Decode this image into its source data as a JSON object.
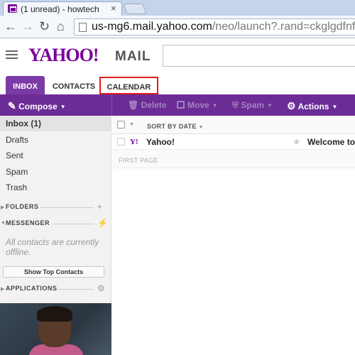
{
  "browser": {
    "tab_title": "(1 unread) - howtech",
    "tab_close": "×",
    "url_host": "us-mg6.mail.yahoo.com",
    "url_path": "/neo/launch?.rand=ckglgdfnfa"
  },
  "header": {
    "logo": "YAHOO!",
    "product": "MAIL"
  },
  "tabs": [
    {
      "label": "INBOX"
    },
    {
      "label": "CONTACTS"
    },
    {
      "label": "CALENDAR"
    }
  ],
  "actions": {
    "compose": "Compose",
    "delete": "Delete",
    "move": "Move",
    "spam": "Spam",
    "actions": "Actions"
  },
  "folders": [
    {
      "label": "Inbox (1)"
    },
    {
      "label": "Drafts"
    },
    {
      "label": "Sent"
    },
    {
      "label": "Spam"
    },
    {
      "label": "Trash"
    }
  ],
  "sections": {
    "folders": "FOLDERS",
    "messenger": "MESSENGER",
    "applications": "APPLICATIONS"
  },
  "messenger": {
    "offline_text": "All contacts are currently offline.",
    "show_contacts_button": "Show Top Contacts"
  },
  "message_list": {
    "sort_label": "SORT BY DATE",
    "page_label": "FIRST PAGE",
    "messages": [
      {
        "sender": "Yahoo!",
        "subject": "Welcome to"
      }
    ]
  },
  "colors": {
    "brand_purple": "#7b0099",
    "action_bar": "#6b2c96",
    "highlight_box": "#e01d1d"
  }
}
